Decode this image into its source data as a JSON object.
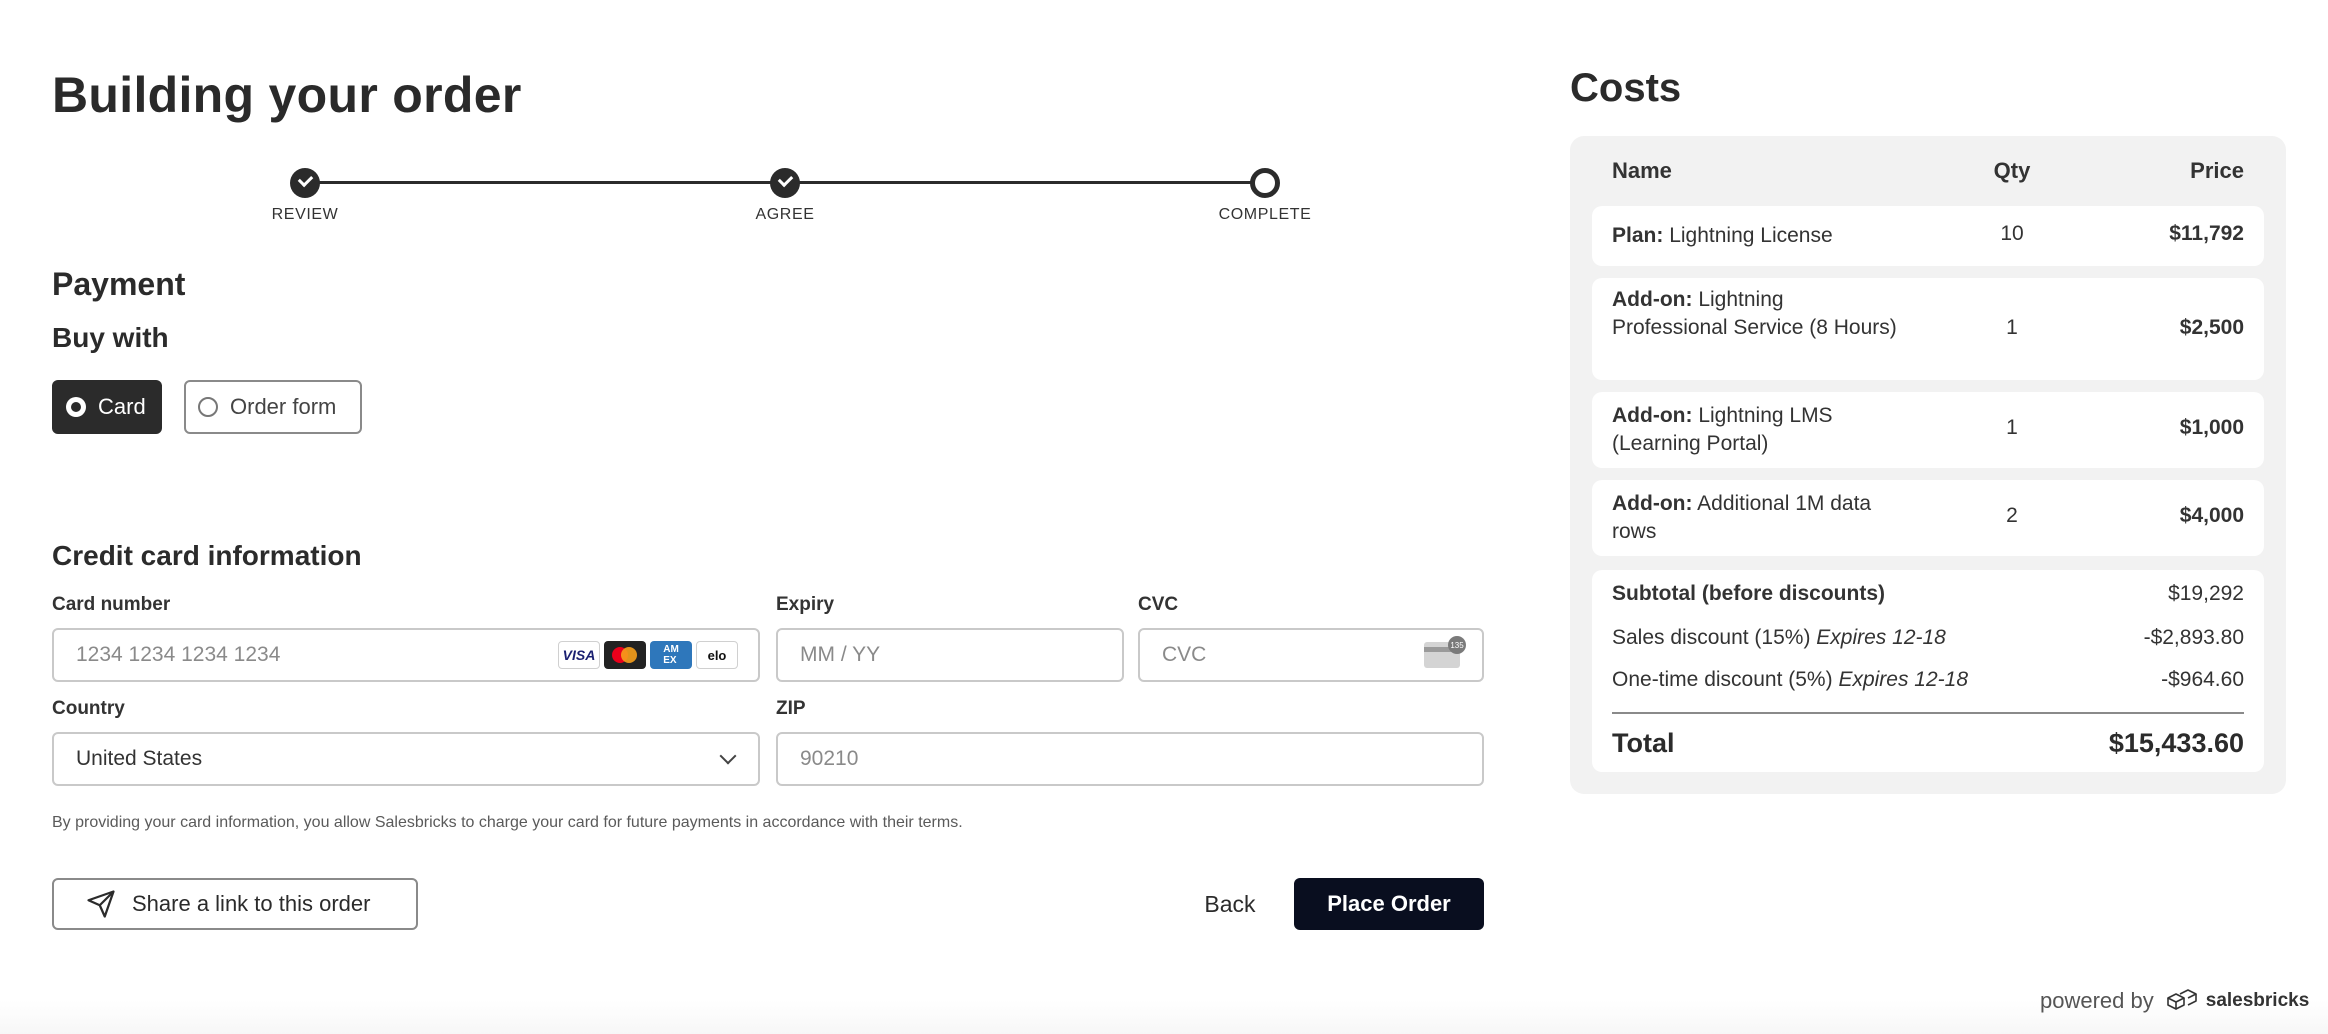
{
  "page_title": "Building your order",
  "stepper": {
    "steps": [
      {
        "label": "REVIEW",
        "state": "done"
      },
      {
        "label": "AGREE",
        "state": "done"
      },
      {
        "label": "COMPLETE",
        "state": "current"
      }
    ]
  },
  "payment": {
    "heading": "Payment",
    "buy_with_heading": "Buy with",
    "options": [
      {
        "label": "Card",
        "selected": true
      },
      {
        "label": "Order form",
        "selected": false
      }
    ]
  },
  "credit_card": {
    "heading": "Credit card information",
    "card_number_label": "Card number",
    "card_number_placeholder": "1234 1234 1234 1234",
    "card_brands": [
      "VISA",
      "Mastercard",
      "AMEX",
      "elo"
    ],
    "expiry_label": "Expiry",
    "expiry_placeholder": "MM / YY",
    "cvc_label": "CVC",
    "cvc_placeholder": "CVC",
    "cvc_badge": "135",
    "country_label": "Country",
    "country_value": "United States",
    "zip_label": "ZIP",
    "zip_placeholder": "90210"
  },
  "disclaimer": "By providing your card information, you allow Salesbricks to charge your card for future payments in accordance with their terms.",
  "actions": {
    "share_label": "Share a link to this order",
    "back_label": "Back",
    "place_order_label": "Place Order"
  },
  "costs": {
    "title": "Costs",
    "headers": {
      "name": "Name",
      "qty": "Qty",
      "price": "Price"
    },
    "items": [
      {
        "prefix": "Plan:",
        "name": "Lightning License",
        "qty": "10",
        "price": "$11,792"
      },
      {
        "prefix": "Add-on:",
        "name": "Lightning Professional Service (8 Hours)",
        "qty": "1",
        "price": "$2,500"
      },
      {
        "prefix": "Add-on:",
        "name": "Lightning LMS (Learning Portal)",
        "qty": "1",
        "price": "$1,000"
      },
      {
        "prefix": "Add-on:",
        "name": "Additional 1M data rows",
        "qty": "2",
        "price": "$4,000"
      }
    ],
    "subtotal_label": "Subtotal (before discounts)",
    "subtotal_value": "$19,292",
    "discounts": [
      {
        "label": "Sales discount (15%)",
        "expires": "Expires 12-18",
        "value": "-$2,893.80"
      },
      {
        "label": "One-time discount (5%)",
        "expires": "Expires 12-18",
        "value": "-$964.60"
      }
    ],
    "total_label": "Total",
    "total_value": "$15,433.60"
  },
  "footer": {
    "powered_by": "powered by",
    "brand": "salesbricks"
  },
  "colors": {
    "primary_dark": "#2b2b2b",
    "place_order_bg": "#090e1f",
    "panel_bg": "#f2f2f2"
  }
}
